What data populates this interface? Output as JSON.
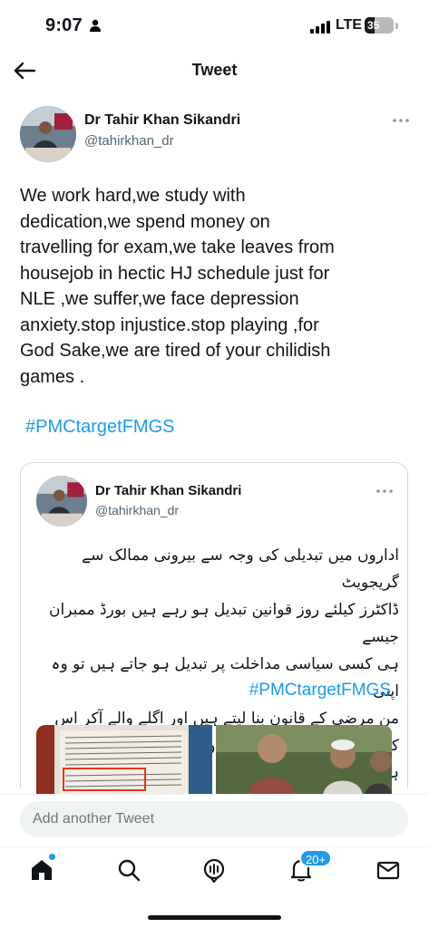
{
  "status_bar": {
    "time": "9:07",
    "network": "LTE",
    "battery": "35",
    "battery_fraction": 0.35
  },
  "header": {
    "title": "Tweet",
    "back_icon": "arrow-left-icon"
  },
  "tweet": {
    "author_name": "Dr Tahir Khan Sikandri",
    "author_handle": "@tahirkhan_dr",
    "text": "We work hard,we study with\ndedication,we spend money on\ntravelling for exam,we take leaves from\nhousejob in hectic HJ schedule just for\nNLE ,we suffer,we face depression\nanxiety.stop injustice.stop playing ,for\nGod Sake,we are tired of your chilidish\ngames .",
    "hashtag": "#PMCtargetFMGS"
  },
  "quoted_tweet": {
    "author_name": "Dr Tahir Khan Sikandri",
    "author_handle": "@tahirkhan_dr",
    "text": "اداروں میں تبدیلی کی وجہ سے بیرونی ممالک سے گریجویٹ\nڈاکٹرز کیلئے روز قوانین تبدیل ہو رہے ہیں بورڈ ممبران جیسے\nہی کسی سیاسی مداخلت پر تبدیل ہو جاتے ہیں تو وہ اپنی\nمن مرضی کے قانون بنا لیتے ہیں اور اگلے والے آکر اس\nکو کالعدم قرار دیتے ہیں اور وقت ڈاکٹرز کا ضائع ہوتا ہے",
    "hashtag": "#PMCtargetFMGS"
  },
  "reply": {
    "placeholder": "Add another Tweet"
  },
  "bottom_nav": {
    "notification_badge": "20+",
    "icons": [
      "home-icon",
      "search-icon",
      "spaces-icon",
      "notifications-icon",
      "messages-icon"
    ]
  },
  "colors": {
    "accent": "#1d9bf0",
    "text": "#0f1419",
    "secondary": "#536471"
  }
}
